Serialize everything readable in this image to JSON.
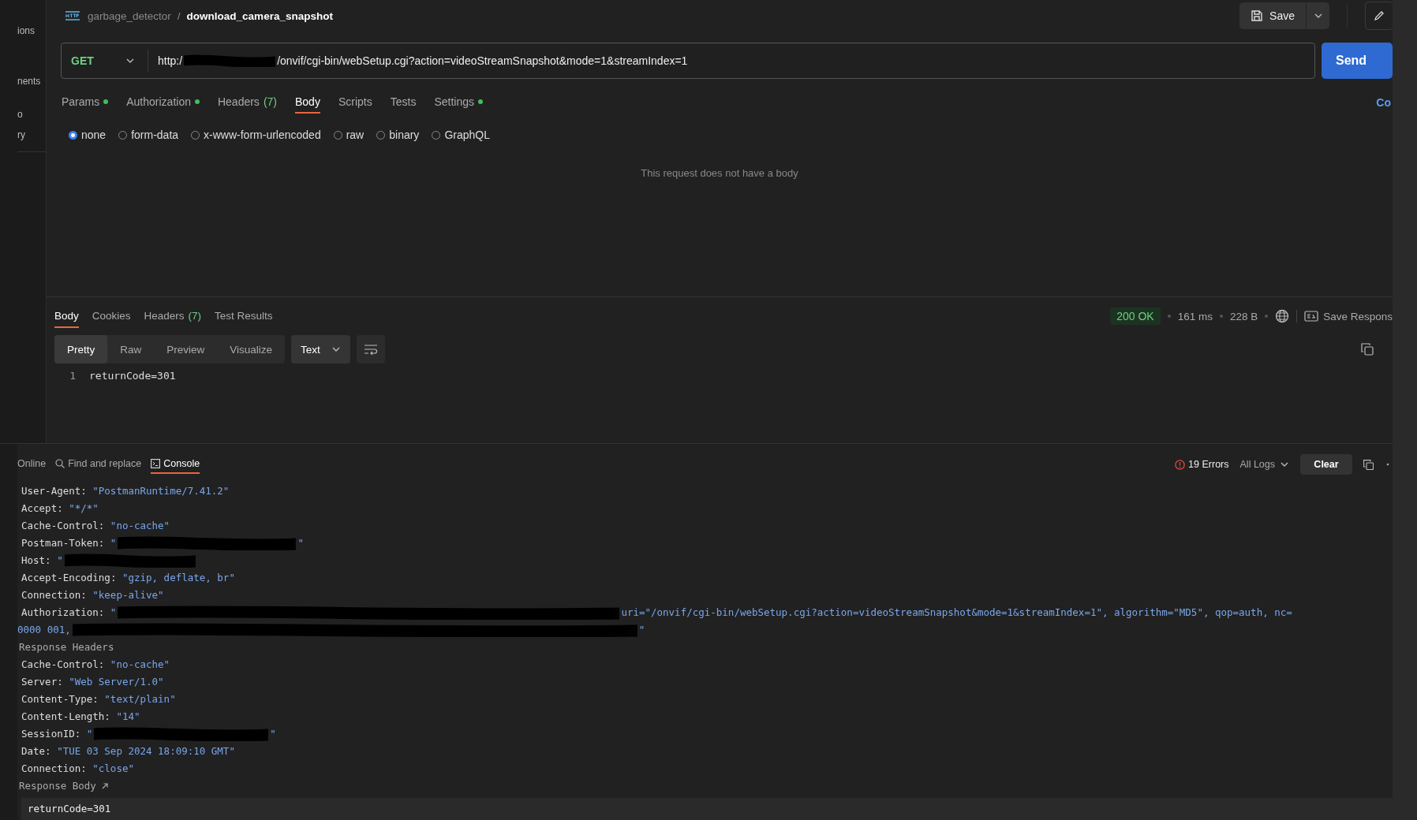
{
  "sidebar": {
    "items": [
      "ions",
      "nents",
      "o",
      "ry"
    ]
  },
  "breadcrumb": {
    "collection": "garbage_detector",
    "separator": "/",
    "request": "download_camera_snapshot"
  },
  "toolbar": {
    "save": "Save"
  },
  "request": {
    "method": "GET",
    "url_start": "http:/",
    "url_redacted": true,
    "url_end": "/onvif/cgi-bin/webSetup.cgi?action=videoStreamSnapshot&mode=1&streamIndex=1",
    "send": "Send"
  },
  "request_tabs": [
    {
      "label": "Params",
      "dot": true,
      "selected": false
    },
    {
      "label": "Authorization",
      "dot": true,
      "selected": false
    },
    {
      "label": "Headers",
      "count": "(7)",
      "dot": false,
      "selected": false
    },
    {
      "label": "Body",
      "dot": false,
      "selected": true
    },
    {
      "label": "Scripts",
      "dot": false,
      "selected": false
    },
    {
      "label": "Tests",
      "dot": false,
      "selected": false
    },
    {
      "label": "Settings",
      "dot": true,
      "selected": false
    }
  ],
  "side_link": "Co",
  "body_types": [
    {
      "label": "none",
      "selected": true
    },
    {
      "label": "form-data",
      "selected": false
    },
    {
      "label": "x-www-form-urlencoded",
      "selected": false
    },
    {
      "label": "raw",
      "selected": false
    },
    {
      "label": "binary",
      "selected": false
    },
    {
      "label": "GraphQL",
      "selected": false
    }
  ],
  "empty_message": "This request does not have a body",
  "response": {
    "tabs": [
      {
        "label": "Body",
        "selected": true
      },
      {
        "label": "Cookies",
        "selected": false
      },
      {
        "label": "Headers",
        "count": "(7)",
        "selected": false
      },
      {
        "label": "Test Results",
        "selected": false
      }
    ],
    "status": "200 OK",
    "time": "161 ms",
    "size": "228 B",
    "save": "Save Respons",
    "formats": [
      {
        "label": "Pretty",
        "selected": true
      },
      {
        "label": "Raw",
        "selected": false
      },
      {
        "label": "Preview",
        "selected": false
      },
      {
        "label": "Visualize",
        "selected": false
      }
    ],
    "language": "Text",
    "lines": [
      {
        "number": "1",
        "text": "returnCode=301"
      }
    ]
  },
  "console": {
    "tabs": [
      {
        "label": "Online",
        "selected": false
      },
      {
        "label": "Find and replace",
        "selected": false
      },
      {
        "label": "Console",
        "selected": true
      }
    ],
    "errors": "19 Errors",
    "filter": "All Logs",
    "clear": "Clear",
    "lines": [
      {
        "kind": "header",
        "key": "User-Agent:",
        "value": "\"PostmanRuntime/7.41.2\""
      },
      {
        "kind": "header",
        "key": "Accept:",
        "value": "\"*/*\""
      },
      {
        "kind": "header",
        "key": "Cache-Control:",
        "value": "\"no-cache\""
      },
      {
        "kind": "header",
        "key": "Postman-Token:",
        "value_start": "\"",
        "redacted": true,
        "value_end": "\""
      },
      {
        "kind": "header",
        "key": "Host:",
        "value_start": "\"",
        "redacted": true
      },
      {
        "kind": "header",
        "key": "Accept-Encoding:",
        "value": "\"gzip, deflate, br\""
      },
      {
        "kind": "header",
        "key": "Connection:",
        "value": "\"keep-alive\""
      },
      {
        "kind": "header",
        "key": "Authorization:",
        "value_start": "\"",
        "redacted": true,
        "value_end": "uri=\"/onvif/cgi-bin/webSetup.cgi?action=videoStreamSnapshot&mode=1&streamIndex=1\", algorithm=\"MD5\", qop=auth, nc="
      },
      {
        "kind": "continuation",
        "value_start": "0000 001,",
        "redacted": true,
        "value_end": "\""
      },
      {
        "kind": "section",
        "text": "Response Headers"
      },
      {
        "kind": "header",
        "key": "Cache-Control:",
        "value": "\"no-cache\""
      },
      {
        "kind": "header",
        "key": "Server:",
        "value": "\"Web Server/1.0\""
      },
      {
        "kind": "header",
        "key": "Content-Type:",
        "value": "\"text/plain\""
      },
      {
        "kind": "header",
        "key": "Content-Length:",
        "value": "\"14\""
      },
      {
        "kind": "header",
        "key": "SessionID:",
        "value_start": "\"",
        "redacted": true,
        "value_end": "\""
      },
      {
        "kind": "header",
        "key": "Date:",
        "value": "\"TUE 03 Sep 2024 18:09:10 GMT\""
      },
      {
        "kind": "header",
        "key": "Connection:",
        "value": "\"close\""
      },
      {
        "kind": "section",
        "text": "Response Body",
        "link": true
      }
    ],
    "body": "returnCode=301"
  }
}
